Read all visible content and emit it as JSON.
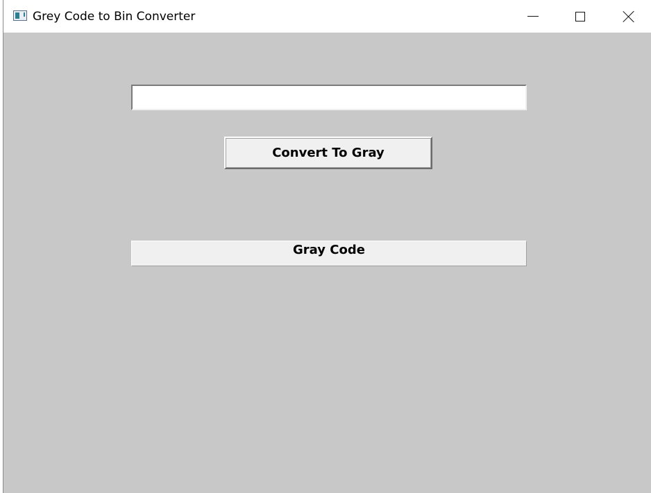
{
  "window": {
    "title": "Grey Code to Bin Converter",
    "icons": {
      "app": "app-window-icon",
      "minimize": "minimize-icon",
      "maximize": "maximize-icon",
      "close": "close-icon"
    }
  },
  "form": {
    "input_value": "",
    "convert_button_label": "Convert To Gray",
    "result_label": "Gray Code"
  },
  "colors": {
    "client_background": "#c8c8c8",
    "control_face": "#f0f0f0",
    "titlebar": "#ffffff"
  }
}
